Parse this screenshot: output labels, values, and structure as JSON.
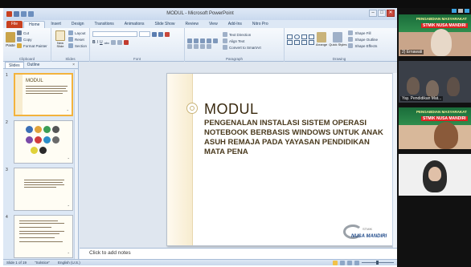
{
  "window": {
    "title": "MODUL - Microsoft PowerPoint",
    "buttons": [
      "–",
      "□",
      "✕"
    ]
  },
  "ribbon": {
    "tabs": [
      "File",
      "Home",
      "Insert",
      "Design",
      "Transitions",
      "Animations",
      "Slide Show",
      "Review",
      "View",
      "Add-Ins",
      "Nitro Pro"
    ],
    "active_tab": "Home",
    "clipboard": {
      "paste": "Paste",
      "cut": "Cut",
      "copy": "Copy",
      "format_painter": "Format Painter",
      "label": "Clipboard"
    },
    "slides": {
      "new_slide": "New Slide",
      "layout": "Layout",
      "reset": "Reset",
      "section": "Section",
      "label": "Slides"
    },
    "font": {
      "label": "Font",
      "bold": "B",
      "italic": "I",
      "underline": "U",
      "strike": "abc"
    },
    "paragraph": {
      "label": "Paragraph",
      "text_direction": "Text Direction",
      "align_text": "Align Text",
      "convert_smartart": "Convert to SmartArt"
    },
    "drawing": {
      "label": "Drawing",
      "arrange": "Arrange",
      "quick_styles": "Quick Styles",
      "shape_fill": "Shape Fill",
      "shape_outline": "Shape Outline",
      "shape_effects": "Shape Effects"
    }
  },
  "pane": {
    "tabs": [
      "Slides",
      "Outline"
    ],
    "active_tab": "Slides",
    "close": "×",
    "thumbnails": [
      {
        "number": "1",
        "title": "MODUL"
      },
      {
        "number": "2",
        "title": ""
      },
      {
        "number": "3",
        "title": ""
      },
      {
        "number": "4",
        "title": ""
      }
    ]
  },
  "slide": {
    "title": "MODUL",
    "subtitle": "PENGENALAN INSTALASI SISTEM OPERASI NOTEBOOK BERBASIS WINDOWS UNTUK ANAK ASUH REMAJA PADA YAYASAN PENDIDIKAN MATA PENA",
    "logo_small": "STMIK",
    "logo_main": "NUSA MANDIRI"
  },
  "notes": {
    "placeholder": "Click to add notes"
  },
  "status": {
    "slide_info": "Slide 1 of 19",
    "theme": "\"Solstice\"",
    "language": "English (U.S.)"
  },
  "video": {
    "banner_line1": "PENGABDIAN MASYARAKAT",
    "banner_line2": "STMIK NUSA MANDIRI",
    "participants": [
      {
        "name": "2) Ernawati"
      },
      {
        "name": "Yay. Pendidikan Mat..."
      },
      {
        "name": ""
      },
      {
        "name": ""
      }
    ]
  },
  "colors": {
    "file_tab": "#c8401f",
    "slide_text": "#4a3a1e",
    "banner_green": "#1a6c3a",
    "logo_blue": "#1f4a8a"
  }
}
